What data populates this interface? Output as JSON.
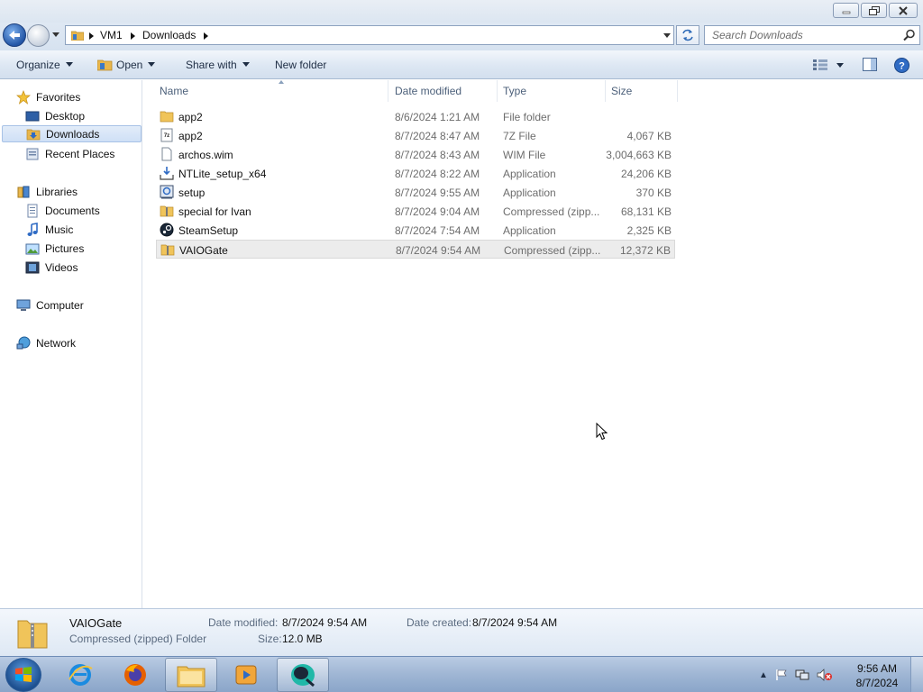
{
  "window": {
    "title": "",
    "minimize_icon": "minimize-icon",
    "maximize_icon": "restore-icon",
    "close_icon": "close-icon"
  },
  "address_bar": {
    "breadcrumbs": [
      "VM1",
      "Downloads"
    ],
    "search_placeholder": "Search Downloads"
  },
  "toolbar": {
    "organize": "Organize",
    "open": "Open",
    "share_with": "Share with",
    "new_folder": "New folder"
  },
  "nav": {
    "favorites": {
      "label": "Favorites",
      "items": [
        "Desktop",
        "Downloads",
        "Recent Places"
      ]
    },
    "libraries": {
      "label": "Libraries",
      "items": [
        "Documents",
        "Music",
        "Pictures",
        "Videos"
      ]
    },
    "computer": "Computer",
    "network": "Network",
    "selected": "Downloads"
  },
  "columns": {
    "name": "Name",
    "date_modified": "Date modified",
    "type": "Type",
    "size": "Size"
  },
  "files": [
    {
      "name": "app2",
      "date": "8/6/2024 1:21 AM",
      "type": "File folder",
      "size": "",
      "icon": "folder-icon"
    },
    {
      "name": "app2",
      "date": "8/7/2024 8:47 AM",
      "type": "7Z File",
      "size": "4,067 KB",
      "icon": "7z-file-icon"
    },
    {
      "name": "archos.wim",
      "date": "8/7/2024 8:43 AM",
      "type": "WIM File",
      "size": "3,004,663 KB",
      "icon": "blank-file-icon"
    },
    {
      "name": "NTLite_setup_x64",
      "date": "8/7/2024 8:22 AM",
      "type": "Application",
      "size": "24,206 KB",
      "icon": "installer-icon"
    },
    {
      "name": "setup",
      "date": "8/7/2024 9:55 AM",
      "type": "Application",
      "size": "370 KB",
      "icon": "setup-app-icon"
    },
    {
      "name": "special for Ivan",
      "date": "8/7/2024 9:04 AM",
      "type": "Compressed (zipp...",
      "size": "68,131 KB",
      "icon": "zip-folder-icon"
    },
    {
      "name": "SteamSetup",
      "date": "8/7/2024 7:54 AM",
      "type": "Application",
      "size": "2,325 KB",
      "icon": "steam-icon"
    },
    {
      "name": "VAIOGate",
      "date": "8/7/2024 9:54 AM",
      "type": "Compressed (zipp...",
      "size": "12,372 KB",
      "icon": "zip-folder-icon"
    }
  ],
  "details": {
    "name": "VAIOGate",
    "type": "Compressed (zipped) Folder",
    "date_modified_label": "Date modified:",
    "date_modified": "8/7/2024 9:54 AM",
    "date_created_label": "Date created:",
    "date_created": "8/7/2024 9:54 AM",
    "size_label": "Size:",
    "size": "12.0 MB"
  },
  "taskbar": {
    "clock_time": "9:56 AM",
    "clock_date": "8/7/2024",
    "apps": [
      "internet-explorer-icon",
      "firefox-icon",
      "file-explorer-icon",
      "media-player-icon",
      "app-icon"
    ]
  }
}
